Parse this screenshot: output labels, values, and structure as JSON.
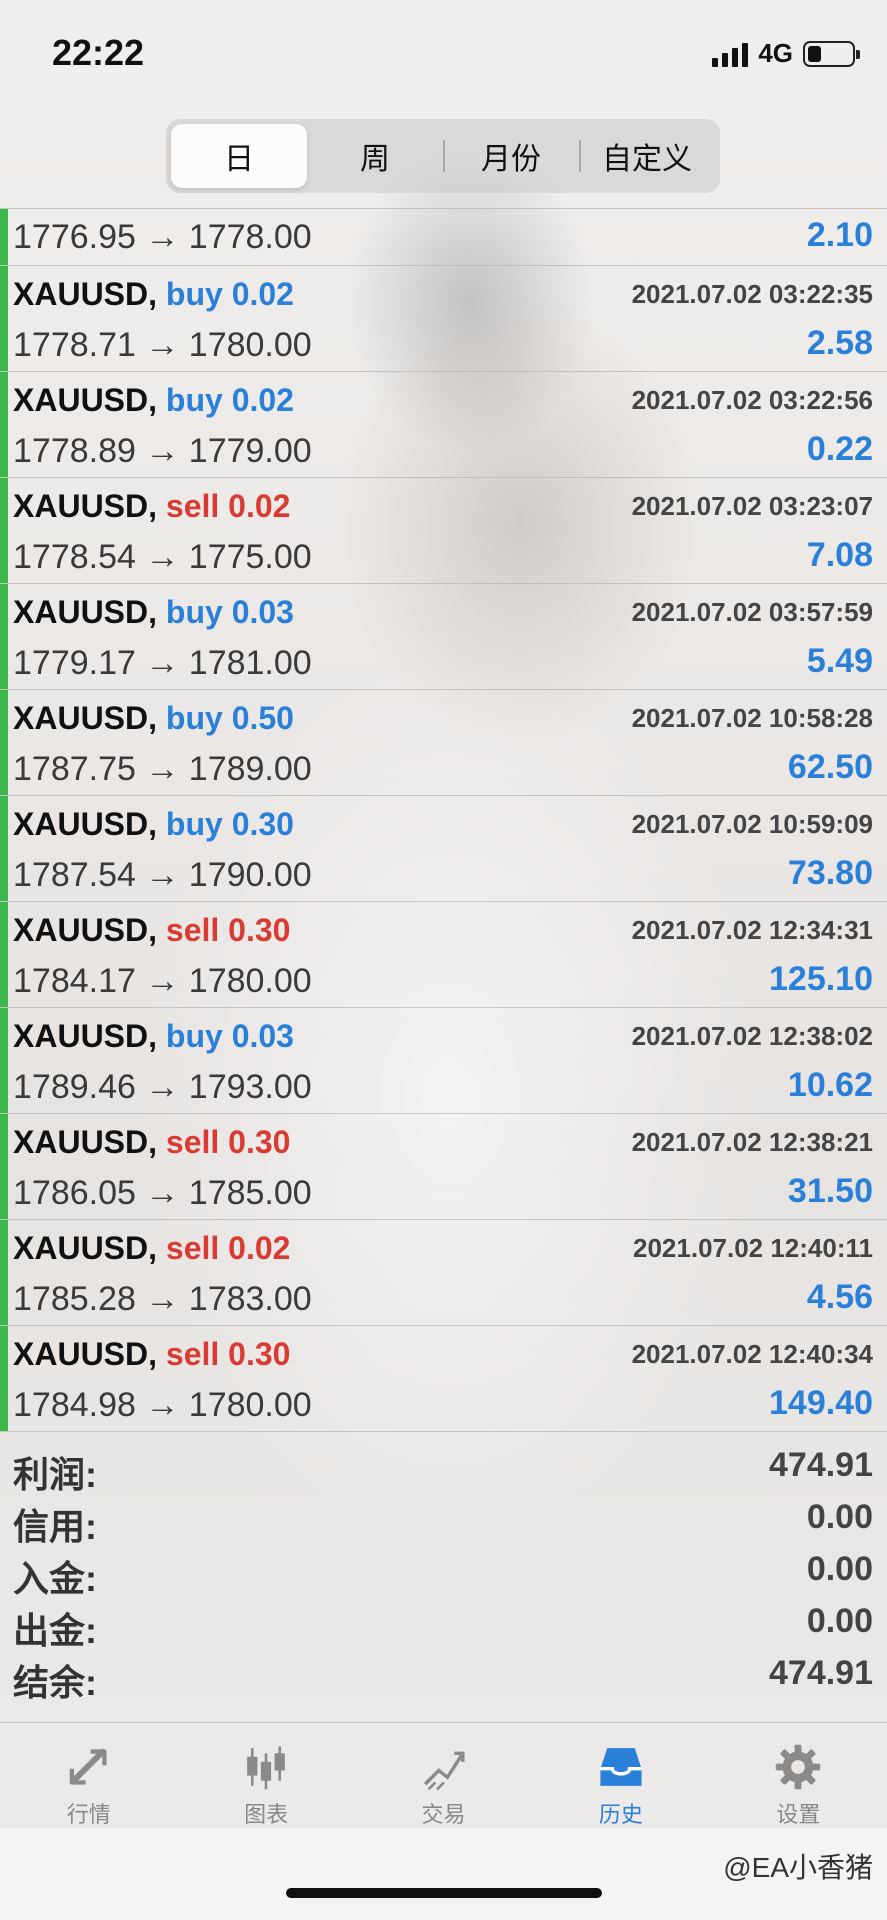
{
  "status_bar": {
    "time": "22:22",
    "network": "4G",
    "battery_level": 0.3
  },
  "period_tabs": [
    {
      "label": "日",
      "active": true
    },
    {
      "label": "周",
      "active": false
    },
    {
      "label": "月份",
      "active": false
    },
    {
      "label": "自定义",
      "active": false
    }
  ],
  "first_row": {
    "prices": "1776.95 → 1778.00",
    "profit": "2.10"
  },
  "trades": [
    {
      "symbol": "XAUUSD,",
      "side": "buy",
      "volume": "0.02",
      "time": "2021.07.02 03:22:35",
      "prices": "1778.71 → 1780.00",
      "profit": "2.58"
    },
    {
      "symbol": "XAUUSD,",
      "side": "buy",
      "volume": "0.02",
      "time": "2021.07.02 03:22:56",
      "prices": "1778.89 → 1779.00",
      "profit": "0.22"
    },
    {
      "symbol": "XAUUSD,",
      "side": "sell",
      "volume": "0.02",
      "time": "2021.07.02 03:23:07",
      "prices": "1778.54 → 1775.00",
      "profit": "7.08"
    },
    {
      "symbol": "XAUUSD,",
      "side": "buy",
      "volume": "0.03",
      "time": "2021.07.02 03:57:59",
      "prices": "1779.17 → 1781.00",
      "profit": "5.49"
    },
    {
      "symbol": "XAUUSD,",
      "side": "buy",
      "volume": "0.50",
      "time": "2021.07.02 10:58:28",
      "prices": "1787.75 → 1789.00",
      "profit": "62.50"
    },
    {
      "symbol": "XAUUSD,",
      "side": "buy",
      "volume": "0.30",
      "time": "2021.07.02 10:59:09",
      "prices": "1787.54 → 1790.00",
      "profit": "73.80"
    },
    {
      "symbol": "XAUUSD,",
      "side": "sell",
      "volume": "0.30",
      "time": "2021.07.02 12:34:31",
      "prices": "1784.17 → 1780.00",
      "profit": "125.10"
    },
    {
      "symbol": "XAUUSD,",
      "side": "buy",
      "volume": "0.03",
      "time": "2021.07.02 12:38:02",
      "prices": "1789.46 → 1793.00",
      "profit": "10.62"
    },
    {
      "symbol": "XAUUSD,",
      "side": "sell",
      "volume": "0.30",
      "time": "2021.07.02 12:38:21",
      "prices": "1786.05 → 1785.00",
      "profit": "31.50"
    },
    {
      "symbol": "XAUUSD,",
      "side": "sell",
      "volume": "0.02",
      "time": "2021.07.02 12:40:11",
      "prices": "1785.28 → 1783.00",
      "profit": "4.56"
    },
    {
      "symbol": "XAUUSD,",
      "side": "sell",
      "volume": "0.30",
      "time": "2021.07.02 12:40:34",
      "prices": "1784.98 → 1780.00",
      "profit": "149.40"
    }
  ],
  "summary": [
    {
      "label": "利润:",
      "value": "474.91"
    },
    {
      "label": "信用:",
      "value": "0.00"
    },
    {
      "label": "入金:",
      "value": "0.00"
    },
    {
      "label": "出金:",
      "value": "0.00"
    },
    {
      "label": "结余:",
      "value": "474.91"
    }
  ],
  "tabbar": [
    {
      "label": "行情",
      "icon": "quotes-arrows-icon",
      "active": false
    },
    {
      "label": "图表",
      "icon": "candlestick-chart-icon",
      "active": false
    },
    {
      "label": "交易",
      "icon": "trade-trend-icon",
      "active": false
    },
    {
      "label": "历史",
      "icon": "history-inbox-icon",
      "active": true
    },
    {
      "label": "设置",
      "icon": "settings-gear-icon",
      "active": false
    }
  ],
  "watermark": "@EA小香猪",
  "colors": {
    "buy": "#2a7fd8",
    "sell": "#d93b32",
    "profit_bar": "#3cb84a",
    "active_tab": "#2a7fd8",
    "inactive_tab": "#888888"
  }
}
